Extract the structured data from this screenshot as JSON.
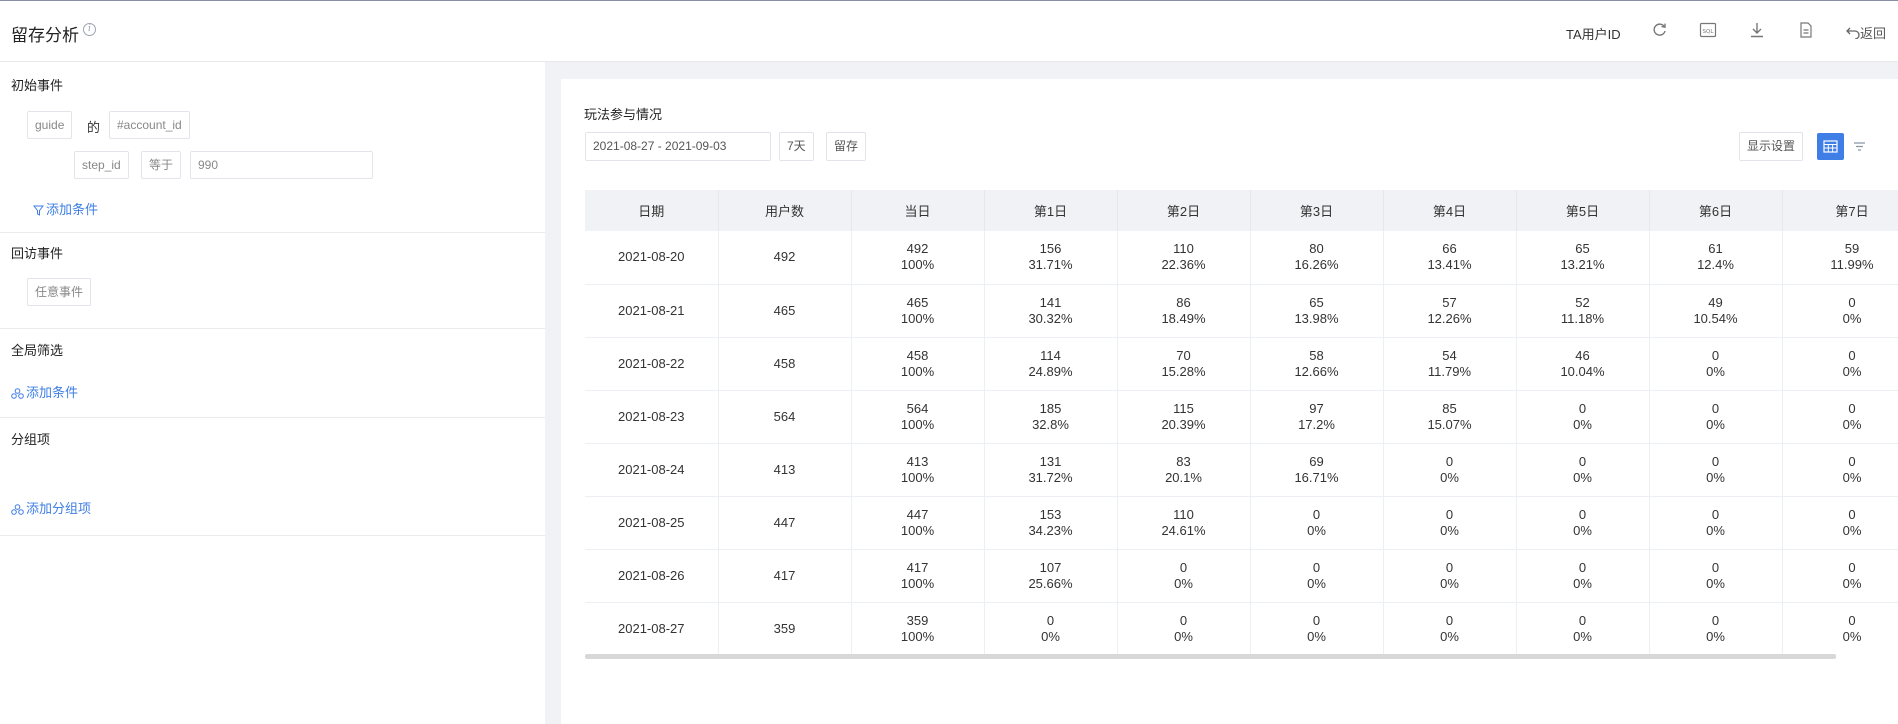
{
  "header": {
    "title": "留存分析",
    "user_id_label": "TA用户ID",
    "back_label": "返回",
    "icons": [
      "refresh-icon",
      "sql-icon",
      "download-icon",
      "document-icon",
      "back-arrow-icon"
    ]
  },
  "left": {
    "initial": {
      "title": "初始事件",
      "event": "guide",
      "of": "的",
      "account": "#account_id",
      "filter_field": "step_id",
      "filter_op": "等于",
      "filter_value": "990",
      "add_condition": "添加条件"
    },
    "return": {
      "title": "回访事件",
      "event": "任意事件"
    },
    "global": {
      "title": "全局筛选",
      "add_condition": "添加条件"
    },
    "group": {
      "title": "分组项",
      "add_group": "添加分组项"
    }
  },
  "content": {
    "title": "玩法参与情况",
    "date_range": "2021-08-27 - 2021-09-03",
    "period": "7天",
    "mode": "留存",
    "display_settings": "显示设置"
  },
  "table": {
    "headers": [
      "日期",
      "用户数",
      "当日",
      "第1日",
      "第2日",
      "第3日",
      "第4日",
      "第5日",
      "第6日",
      "第7日"
    ],
    "rows": [
      {
        "date": "2021-08-20",
        "users": "492",
        "cells": [
          [
            "492",
            "100%"
          ],
          [
            "156",
            "31.71%"
          ],
          [
            "110",
            "22.36%"
          ],
          [
            "80",
            "16.26%"
          ],
          [
            "66",
            "13.41%"
          ],
          [
            "65",
            "13.21%"
          ],
          [
            "61",
            "12.4%"
          ],
          [
            "59",
            "11.99%"
          ]
        ]
      },
      {
        "date": "2021-08-21",
        "users": "465",
        "cells": [
          [
            "465",
            "100%"
          ],
          [
            "141",
            "30.32%"
          ],
          [
            "86",
            "18.49%"
          ],
          [
            "65",
            "13.98%"
          ],
          [
            "57",
            "12.26%"
          ],
          [
            "52",
            "11.18%"
          ],
          [
            "49",
            "10.54%"
          ],
          [
            "0",
            "0%"
          ]
        ]
      },
      {
        "date": "2021-08-22",
        "users": "458",
        "cells": [
          [
            "458",
            "100%"
          ],
          [
            "114",
            "24.89%"
          ],
          [
            "70",
            "15.28%"
          ],
          [
            "58",
            "12.66%"
          ],
          [
            "54",
            "11.79%"
          ],
          [
            "46",
            "10.04%"
          ],
          [
            "0",
            "0%"
          ],
          [
            "0",
            "0%"
          ]
        ]
      },
      {
        "date": "2021-08-23",
        "users": "564",
        "cells": [
          [
            "564",
            "100%"
          ],
          [
            "185",
            "32.8%"
          ],
          [
            "115",
            "20.39%"
          ],
          [
            "97",
            "17.2%"
          ],
          [
            "85",
            "15.07%"
          ],
          [
            "0",
            "0%"
          ],
          [
            "0",
            "0%"
          ],
          [
            "0",
            "0%"
          ]
        ]
      },
      {
        "date": "2021-08-24",
        "users": "413",
        "cells": [
          [
            "413",
            "100%"
          ],
          [
            "131",
            "31.72%"
          ],
          [
            "83",
            "20.1%"
          ],
          [
            "69",
            "16.71%"
          ],
          [
            "0",
            "0%"
          ],
          [
            "0",
            "0%"
          ],
          [
            "0",
            "0%"
          ],
          [
            "0",
            "0%"
          ]
        ]
      },
      {
        "date": "2021-08-25",
        "users": "447",
        "cells": [
          [
            "447",
            "100%"
          ],
          [
            "153",
            "34.23%"
          ],
          [
            "110",
            "24.61%"
          ],
          [
            "0",
            "0%"
          ],
          [
            "0",
            "0%"
          ],
          [
            "0",
            "0%"
          ],
          [
            "0",
            "0%"
          ],
          [
            "0",
            "0%"
          ]
        ]
      },
      {
        "date": "2021-08-26",
        "users": "417",
        "cells": [
          [
            "417",
            "100%"
          ],
          [
            "107",
            "25.66%"
          ],
          [
            "0",
            "0%"
          ],
          [
            "0",
            "0%"
          ],
          [
            "0",
            "0%"
          ],
          [
            "0",
            "0%"
          ],
          [
            "0",
            "0%"
          ],
          [
            "0",
            "0%"
          ]
        ]
      },
      {
        "date": "2021-08-27",
        "users": "359",
        "cells": [
          [
            "359",
            "100%"
          ],
          [
            "0",
            "0%"
          ],
          [
            "0",
            "0%"
          ],
          [
            "0",
            "0%"
          ],
          [
            "0",
            "0%"
          ],
          [
            "0",
            "0%"
          ],
          [
            "0",
            "0%"
          ],
          [
            "0",
            "0%"
          ]
        ]
      }
    ]
  },
  "colors": {
    "accent": "#3e7ee6",
    "header_bg": "#f0f2f5"
  }
}
